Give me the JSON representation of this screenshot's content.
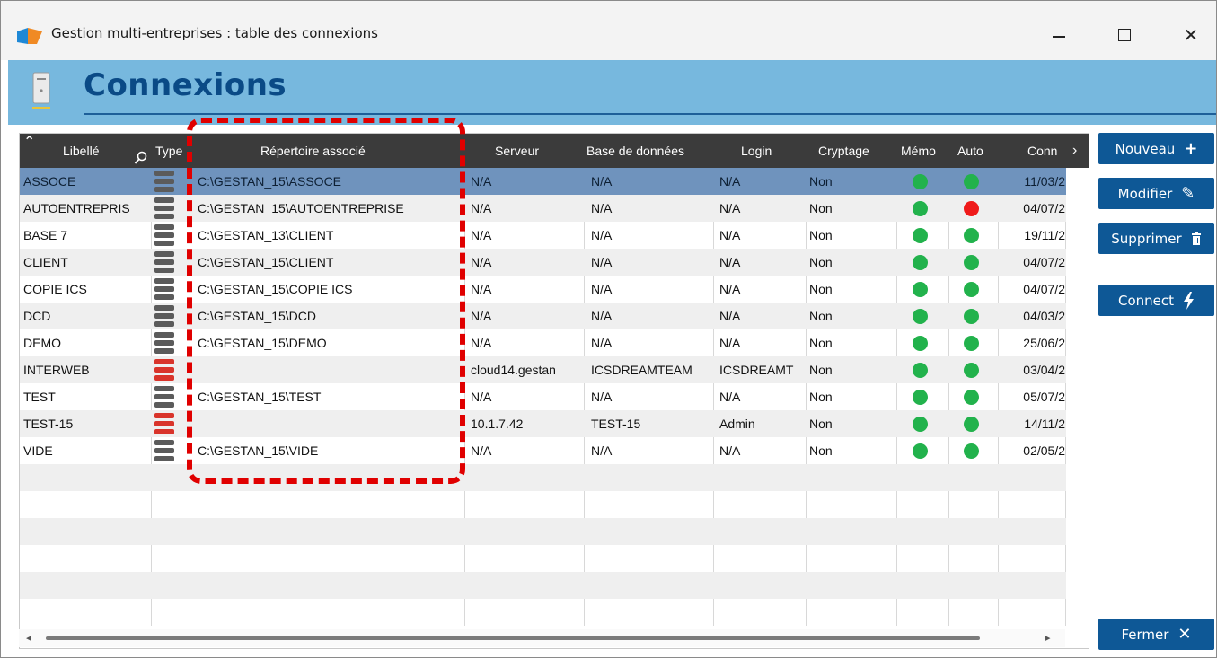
{
  "window": {
    "title": "Gestion multi-entreprises : table des connexions",
    "minimize": "—",
    "maximize": "☐",
    "close": "✕"
  },
  "banner": {
    "title": "Connexions"
  },
  "columns": {
    "libelle": "Libellé",
    "type": "Type",
    "repertoire": "Répertoire associé",
    "serveur": "Serveur",
    "base": "Base de données",
    "login": "Login",
    "cryptage": "Cryptage",
    "memo": "Mémo",
    "auto": "Auto",
    "conn": "Conn"
  },
  "rows": [
    {
      "libelle": "ASSOCE",
      "type": "gray",
      "repertoire": "C:\\GESTAN_15\\ASSOCE",
      "serveur": "N/A",
      "base": "N/A",
      "login": "N/A",
      "cryptage": "Non",
      "memo": "green",
      "auto": "green",
      "conn": "11/03/2"
    },
    {
      "libelle": "AUTOENTREPRIS",
      "type": "gray",
      "repertoire": "C:\\GESTAN_15\\AUTOENTREPRISE",
      "serveur": "N/A",
      "base": "N/A",
      "login": "N/A",
      "cryptage": "Non",
      "memo": "green",
      "auto": "red",
      "conn": "04/07/2"
    },
    {
      "libelle": "BASE 7",
      "type": "gray",
      "repertoire": "C:\\GESTAN_13\\CLIENT",
      "serveur": "N/A",
      "base": "N/A",
      "login": "N/A",
      "cryptage": "Non",
      "memo": "green",
      "auto": "green",
      "conn": "19/11/2"
    },
    {
      "libelle": "CLIENT",
      "type": "gray",
      "repertoire": "C:\\GESTAN_15\\CLIENT",
      "serveur": "N/A",
      "base": "N/A",
      "login": "N/A",
      "cryptage": "Non",
      "memo": "green",
      "auto": "green",
      "conn": "04/07/2"
    },
    {
      "libelle": "COPIE ICS",
      "type": "gray",
      "repertoire": "C:\\GESTAN_15\\COPIE ICS",
      "serveur": "N/A",
      "base": "N/A",
      "login": "N/A",
      "cryptage": "Non",
      "memo": "green",
      "auto": "green",
      "conn": "04/07/2"
    },
    {
      "libelle": "DCD",
      "type": "gray",
      "repertoire": "C:\\GESTAN_15\\DCD",
      "serveur": "N/A",
      "base": "N/A",
      "login": "N/A",
      "cryptage": "Non",
      "memo": "green",
      "auto": "green",
      "conn": "04/03/2"
    },
    {
      "libelle": "DEMO",
      "type": "gray",
      "repertoire": "C:\\GESTAN_15\\DEMO",
      "serveur": "N/A",
      "base": "N/A",
      "login": "N/A",
      "cryptage": "Non",
      "memo": "green",
      "auto": "green",
      "conn": "25/06/2"
    },
    {
      "libelle": "INTERWEB",
      "type": "red",
      "repertoire": "",
      "serveur": "cloud14.gestan",
      "base": "ICSDREAMTEAM",
      "login": "ICSDREAMT",
      "cryptage": "Non",
      "memo": "green",
      "auto": "green",
      "conn": "03/04/2"
    },
    {
      "libelle": "TEST",
      "type": "gray",
      "repertoire": "C:\\GESTAN_15\\TEST",
      "serveur": "N/A",
      "base": "N/A",
      "login": "N/A",
      "cryptage": "Non",
      "memo": "green",
      "auto": "green",
      "conn": "05/07/2"
    },
    {
      "libelle": "TEST-15",
      "type": "red",
      "repertoire": "",
      "serveur": "10.1.7.42",
      "base": "TEST-15",
      "login": "Admin",
      "cryptage": "Non",
      "memo": "green",
      "auto": "green",
      "conn": "14/11/2"
    },
    {
      "libelle": "VIDE",
      "type": "gray",
      "repertoire": "C:\\GESTAN_15\\VIDE",
      "serveur": "N/A",
      "base": "N/A",
      "login": "N/A",
      "cryptage": "Non",
      "memo": "green",
      "auto": "green",
      "conn": "02/05/2"
    }
  ],
  "selected_row": 0,
  "buttons": {
    "nouveau": "Nouveau",
    "modifier": "Modifier",
    "supprimer": "Supprimer",
    "connect": "Connect",
    "fermer": "Fermer"
  },
  "colors": {
    "accent": "#0e5896",
    "banner": "#77b8de",
    "header": "#3b3b3b",
    "selected": "#6f93bd",
    "status_green": "#22b24c",
    "status_red": "#ef1a1a",
    "highlight": "#e00000"
  },
  "icons": {
    "app": "app-logo-icon",
    "banner": "server-tower-icon",
    "sort": "sort-up-caret-icon",
    "search": "search-icon",
    "scroll_right": "chevron-right-icon",
    "nouveau": "plus-icon",
    "modifier": "pencil-icon",
    "supprimer": "trash-icon",
    "connect": "lightning-icon",
    "fermer": "close-icon"
  }
}
